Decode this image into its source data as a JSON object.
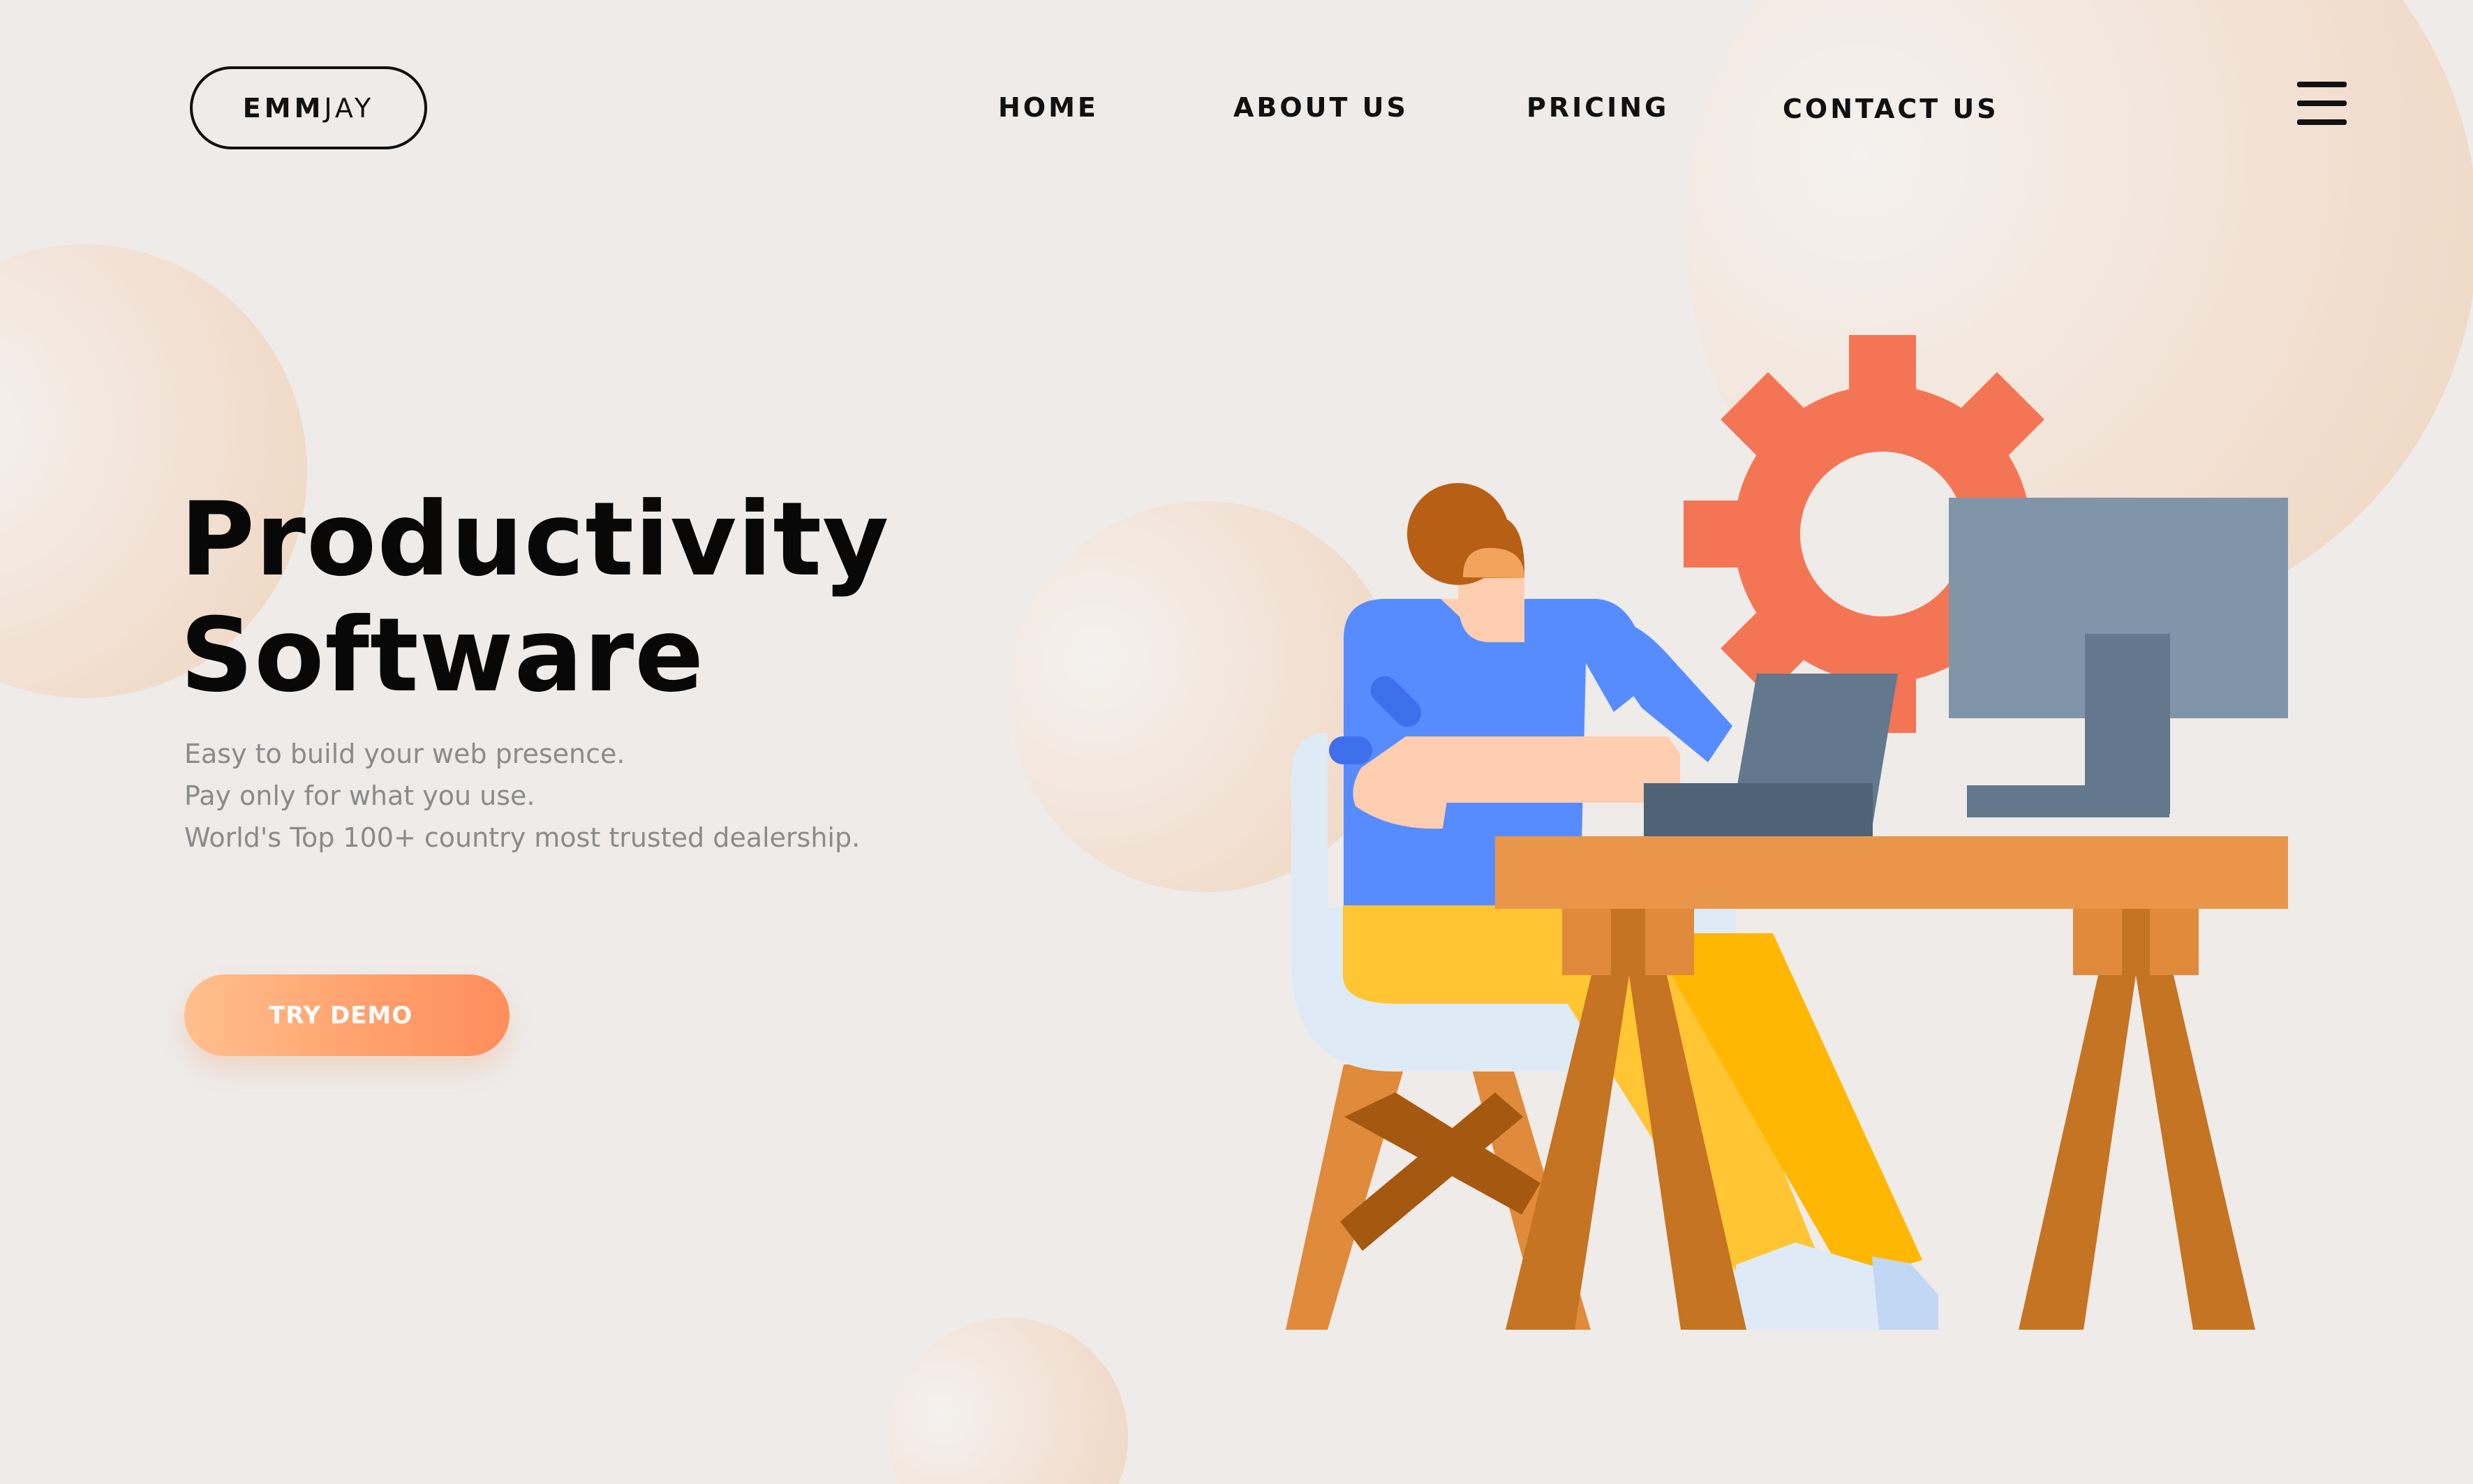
{
  "header": {
    "logo_bold": "EMM",
    "logo_light": "JAY",
    "nav": [
      {
        "label": "HOME"
      },
      {
        "label": "ABOUT US"
      },
      {
        "label": "PRICING"
      },
      {
        "label": "CONTACT US"
      }
    ],
    "menu_icon": "hamburger-icon"
  },
  "hero": {
    "title_line1": "Productivity",
    "title_line2": "Software",
    "copy": [
      "Easy to build your web presence.",
      "Pay only for what you use.",
      "World's Top 100+ country most trusted dealership."
    ],
    "cta_label": "TRY DEMO"
  },
  "illustration": {
    "subject": "person-working-at-desk",
    "elements": [
      "gear-icon",
      "monitor",
      "laptop",
      "chair",
      "desk",
      "person"
    ]
  },
  "colors": {
    "background": "#eeebe9",
    "accent": "#ff9b68",
    "gear": "#f47554",
    "desk": "#e9964b",
    "monitor": "#8195a8",
    "shirt": "#568cff",
    "pants": "#ffc533"
  }
}
